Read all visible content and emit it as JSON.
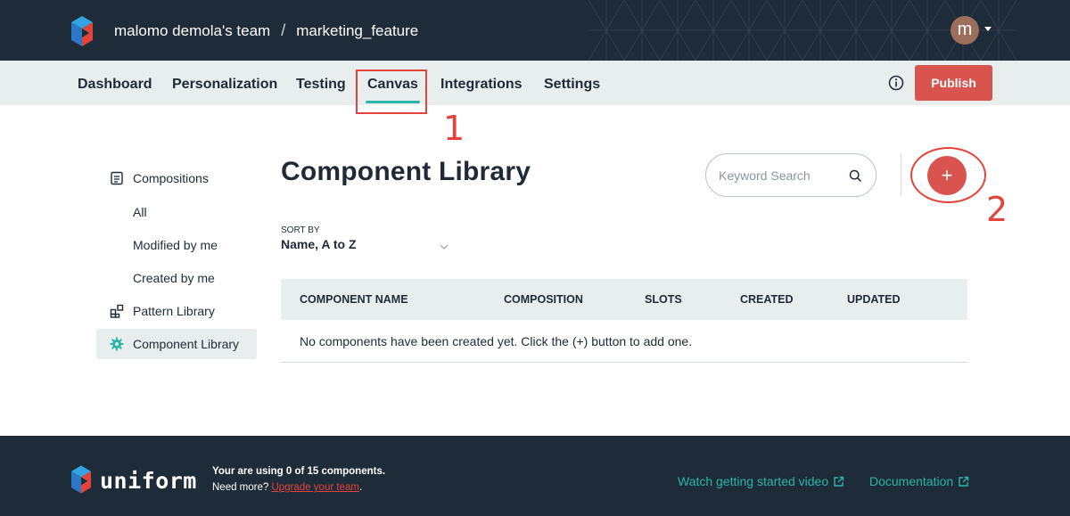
{
  "header": {
    "team_name": "malomo demola's team",
    "separator": "/",
    "project_name": "marketing_feature",
    "avatar_initial": "m"
  },
  "nav": {
    "tabs": [
      {
        "label": "Dashboard"
      },
      {
        "label": "Personalization"
      },
      {
        "label": "Testing"
      },
      {
        "label": "Canvas",
        "active": true
      },
      {
        "label": "Integrations"
      },
      {
        "label": "Settings"
      }
    ],
    "publish_label": "Publish"
  },
  "annotations": {
    "first": "1",
    "second": "2"
  },
  "sidebar": {
    "items": [
      {
        "label": "Compositions",
        "icon": "document-icon"
      },
      {
        "label": "All"
      },
      {
        "label": "Modified by me"
      },
      {
        "label": "Created by me"
      },
      {
        "label": "Pattern Library",
        "icon": "grid-icon"
      },
      {
        "label": "Component Library",
        "icon": "gear-icon",
        "active": true
      }
    ]
  },
  "main": {
    "title": "Component Library",
    "search_placeholder": "Keyword Search",
    "add_label": "+",
    "sort": {
      "label": "SORT BY",
      "value": "Name, A to Z"
    },
    "table": {
      "columns": [
        "COMPONENT NAME",
        "COMPOSITION",
        "SLOTS",
        "CREATED",
        "UPDATED"
      ],
      "empty_message": "No components have been created yet. Click the (+) button to add one."
    }
  },
  "footer": {
    "brand": "uniform",
    "usage_text": "Your are using 0 of 15 components.",
    "need_more": "Need more?",
    "upgrade_link": "Upgrade your team",
    "period": ".",
    "video_link": "Watch getting started video",
    "docs_link": "Documentation"
  },
  "colors": {
    "header_bg": "#1e2b38",
    "accent": "#2bb5a8",
    "primary_button": "#d9534f",
    "annotation": "#e2443c",
    "nav_bg": "#e8eeee"
  }
}
